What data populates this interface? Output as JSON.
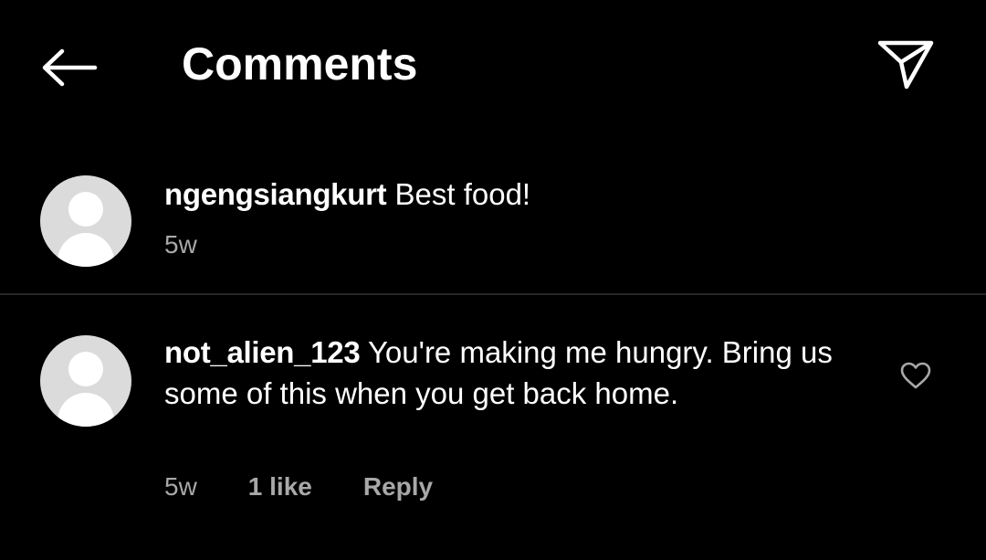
{
  "header": {
    "title": "Comments",
    "back_icon": "arrow-left-icon",
    "share_icon": "paper-plane-icon"
  },
  "comments": [
    {
      "username": "ngengsiangkurt",
      "text": "Best food!",
      "time": "5w",
      "avatar_icon": "default-avatar-icon"
    },
    {
      "username": "not_alien_123",
      "text": "You're making me hungry. Bring us some of this when you get back home.",
      "time": "5w",
      "likes": "1 like",
      "reply_label": "Reply",
      "avatar_icon": "default-avatar-icon",
      "like_icon": "heart-outline-icon"
    }
  ],
  "colors": {
    "background": "#000000",
    "text_primary": "#ffffff",
    "text_secondary": "#a8a8a8",
    "avatar_bg": "#dbdbdb",
    "divider": "#262626"
  }
}
